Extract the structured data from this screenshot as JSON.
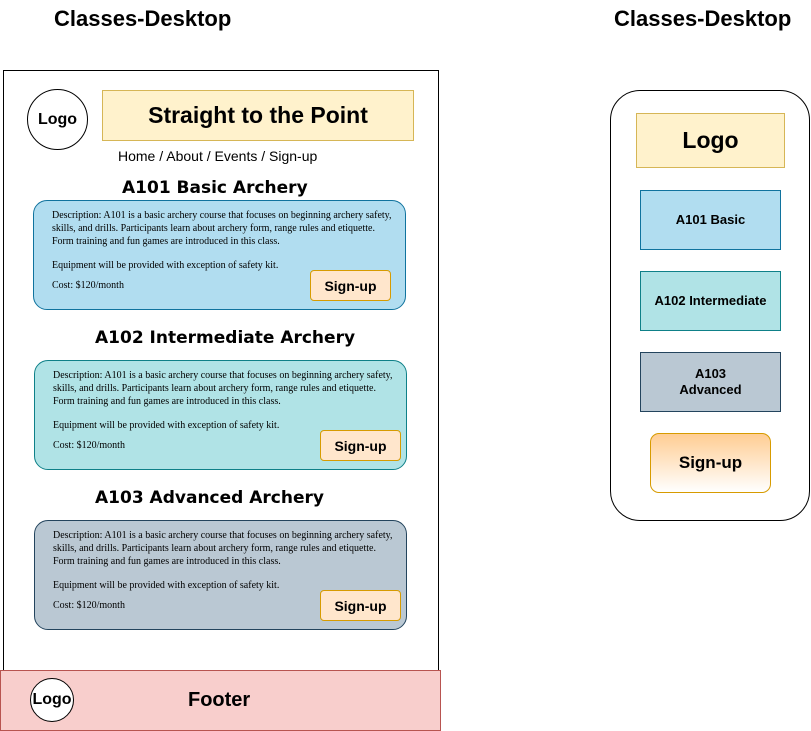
{
  "left_title": "Classes-Desktop",
  "right_title": "Classes-Desktop",
  "header": {
    "logo": "Logo",
    "title": "Straight to the Point"
  },
  "nav": {
    "home": "Home",
    "about": "About",
    "events": "Events",
    "signup": "Sign-up",
    "separator": "/"
  },
  "courses": [
    {
      "title": "A101 Basic Archery",
      "description": "Description: A101 is a basic archery course that focuses on beginning archery safety, skills, and drills. Participants learn about archery form, range rules and etiquette. Form training and fun games are introduced in this class.",
      "equipment": "Equipment will be provided with exception of safety kit.",
      "cost": "Cost: $120/month",
      "button": "Sign-up"
    },
    {
      "title": "A102 Intermediate Archery",
      "description": "Description: A101 is a basic archery course that focuses on beginning archery safety, skills, and drills. Participants learn about archery form, range rules and etiquette. Form training and fun games are introduced in this class.",
      "equipment": "Equipment will be provided with exception of safety kit.",
      "cost": "Cost: $120/month",
      "button": "Sign-up"
    },
    {
      "title": "A103 Advanced Archery",
      "description": "Description: A101 is a basic archery course that focuses on beginning archery safety, skills, and drills. Participants learn about archery form, range rules and etiquette. Form training and fun games are introduced in this class.",
      "equipment": "Equipment will be provided with exception of safety kit.",
      "cost": "Cost: $120/month",
      "button": "Sign-up"
    }
  ],
  "footer": {
    "logo": "Logo",
    "label": "Footer"
  },
  "mobile": {
    "logo": "Logo",
    "buttons": [
      {
        "line1": "A101 Basic",
        "line2": ""
      },
      {
        "line1": "A102 Intermediate",
        "line2": ""
      },
      {
        "line1": "A103",
        "line2": "Advanced"
      }
    ],
    "signup": "Sign-up"
  },
  "colors": {
    "header_fill": "#fff2cc",
    "card_basic": "#b1ddf0",
    "card_intermediate": "#b0e3e6",
    "card_advanced": "#bac8d3",
    "signup_fill": "#ffe6cc",
    "footer_fill": "#f8cecc"
  }
}
